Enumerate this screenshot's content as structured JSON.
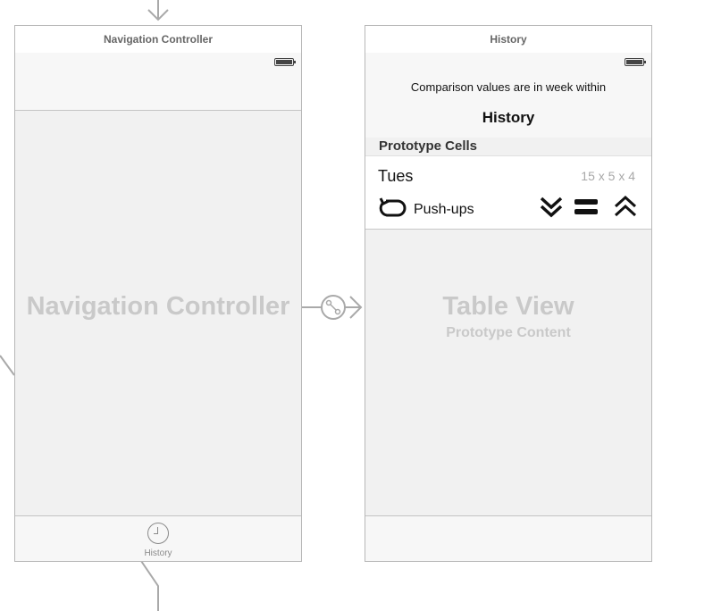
{
  "entry_arrow_icon": "arrow-down-icon",
  "segue_icon": "segue-relationship-icon",
  "navigation_controller": {
    "title": "Navigation Controller",
    "placeholder_label": "Navigation Controller",
    "tab_item": {
      "label": "History",
      "icon": "clock-icon"
    }
  },
  "history_scene": {
    "title": "History",
    "subtitle": "Comparison values are in week within",
    "nav_title": "History",
    "section_header": "Prototype Cells",
    "cell": {
      "day": "Tues",
      "reps": "15 x 5 x 4",
      "exercise": "Push-ups",
      "icons": [
        "repeat-icon",
        "double-chevron-down-icon",
        "equals-icon",
        "double-chevron-up-icon"
      ]
    },
    "table_view_label": "Table View",
    "table_view_sublabel": "Prototype Content"
  },
  "colors": {
    "canvas": "#ffffff",
    "scene_background": "#f1f1f1",
    "placeholder_text": "#c9c9c9",
    "connector": "#a9a9a9"
  }
}
